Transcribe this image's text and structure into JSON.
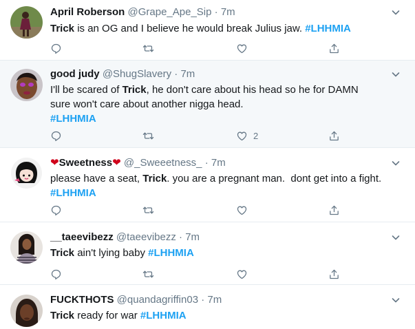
{
  "colors": {
    "accent": "#1da1f2",
    "secondary": "#657786",
    "border": "#e6ecf0",
    "highlight": "#f5f8fa"
  },
  "tweets": [
    {
      "name": "April Roberson",
      "handle": "@Grape_Ape_Sip",
      "time": "7m",
      "text_bold": "Trick",
      "text": " is an OG and I believe he would break Julius jaw. ",
      "hashtag": "#LHHMIA",
      "likes": ""
    },
    {
      "name": "good judy",
      "handle": "@ShugSlavery",
      "time": "7m",
      "text_pre": "I'll be scared of ",
      "text_bold": "Trick",
      "text": ", he don't care about his head so he for DAMN sure won't care about another nigga head.",
      "hashtag": "#LHHMIA",
      "likes": "2"
    },
    {
      "name_heart_left": "❤",
      "name": "Sweetness",
      "name_heart_right": "❤",
      "handle": "@_Sweeetness_",
      "time": "7m",
      "text_pre": "please have a seat, ",
      "text_bold": "Trick",
      "text": ". you are a pregnant man.  dont get into a fight.",
      "hashtag": "#LHHMIA",
      "likes": ""
    },
    {
      "name": "__taeevibezz",
      "handle": "@taeevibezz",
      "time": "7m",
      "text_bold": "Trick",
      "text": " ain't lying baby ",
      "hashtag": "#LHHMIA",
      "likes": ""
    },
    {
      "name": "FUCKTHOTS",
      "handle": "@quandagriffin03",
      "time": "7m",
      "text_bold": "Trick",
      "text": " ready for war ",
      "hashtag": "#LHHMIA",
      "likes": ""
    }
  ],
  "icons": [
    "reply-icon",
    "retweet-icon",
    "like-icon",
    "share-icon",
    "caret-down-icon"
  ]
}
